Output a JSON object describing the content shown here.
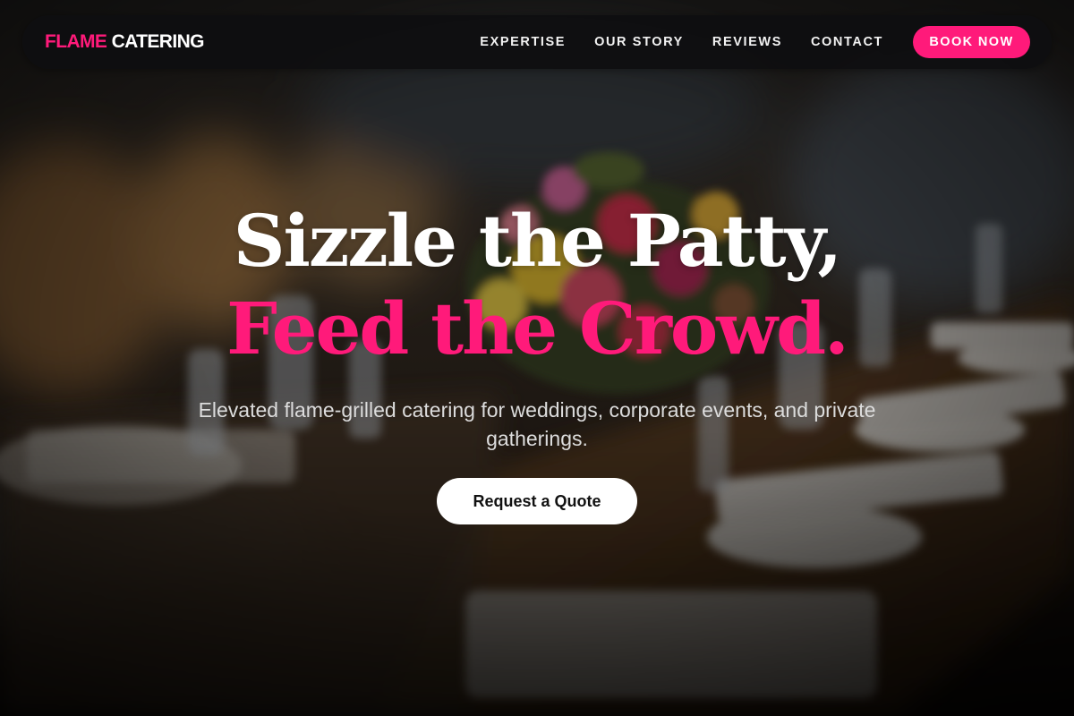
{
  "brand": {
    "part1": "FLAME",
    "part2": " CATERING"
  },
  "nav": {
    "links": [
      "EXPERTISE",
      "OUR STORY",
      "REVIEWS",
      "CONTACT"
    ],
    "cta": "BOOK NOW"
  },
  "hero": {
    "headline_line1": "Sizzle the Patty,",
    "headline_line2": "Feed the Crowd.",
    "subtitle": "Elevated flame-grilled catering for weddings, corporate events, and private gatherings.",
    "cta": "Request a Quote"
  },
  "colors": {
    "accent": "#ff1a7a",
    "navbar_bg": "#0e0e10",
    "text_light": "#ffffff",
    "overlay": "#000000"
  }
}
